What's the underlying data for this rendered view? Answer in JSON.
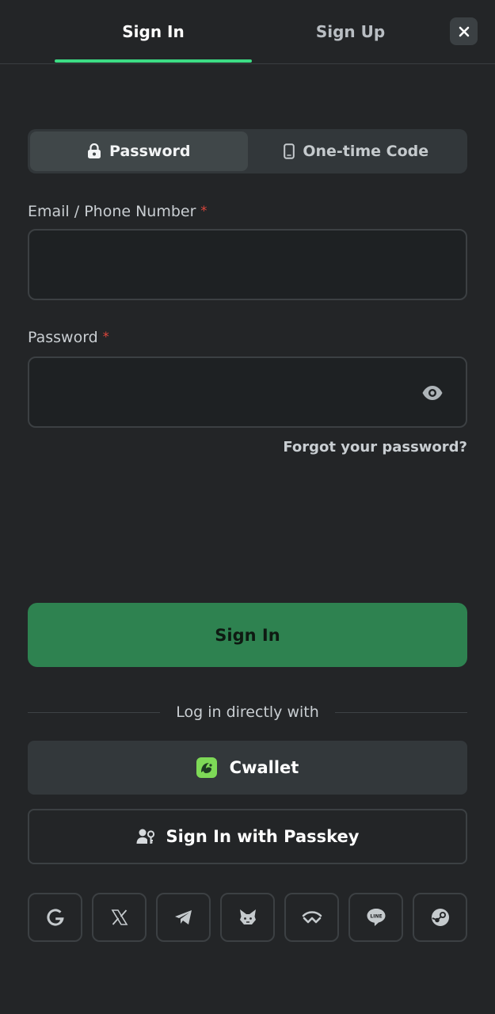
{
  "tabs": {
    "signin": "Sign In",
    "signup": "Sign Up"
  },
  "segment": {
    "password": "Password",
    "otp": "One-time Code"
  },
  "form": {
    "email_label": "Email / Phone Number",
    "email_value": "",
    "password_label": "Password",
    "password_value": "",
    "required_mark": "*",
    "forgot": "Forgot your password?"
  },
  "actions": {
    "signin_button": "Sign In",
    "divider": "Log in directly with",
    "cwallet": "Cwallet",
    "passkey": "Sign In with Passkey"
  },
  "social": [
    "google-icon",
    "x-icon",
    "telegram-icon",
    "metamask-icon",
    "walletconnect-icon",
    "line-icon",
    "steam-icon"
  ],
  "colors": {
    "accent_green": "#3ddc84",
    "primary_button": "#2e8250",
    "required": "#e0463c",
    "background": "#232527"
  }
}
